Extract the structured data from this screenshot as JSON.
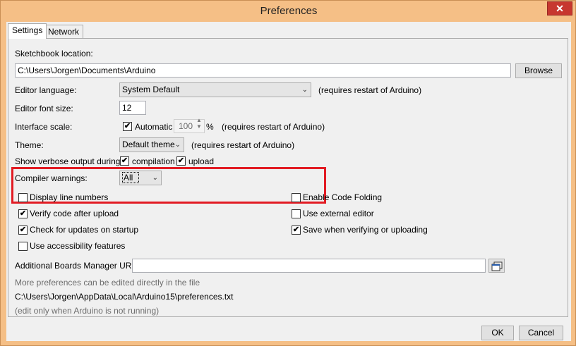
{
  "window": {
    "title": "Preferences",
    "close_glyph": "✕"
  },
  "tabs": [
    {
      "label": "Settings"
    },
    {
      "label": "Network"
    }
  ],
  "sketchbook": {
    "label": "Sketchbook location:",
    "value": "C:\\Users\\Jorgen\\Documents\\Arduino",
    "browse_label": "Browse"
  },
  "editor_language": {
    "label": "Editor language:",
    "value": "System Default",
    "note": "(requires restart of Arduino)"
  },
  "font_size": {
    "label": "Editor font size:",
    "value": "12"
  },
  "interface_scale": {
    "label": "Interface scale:",
    "automatic_label": "Automatic",
    "value": "100",
    "unit": "%",
    "note": "(requires restart of Arduino)"
  },
  "theme": {
    "label": "Theme:",
    "value": "Default theme",
    "note": "(requires restart of Arduino)"
  },
  "verbose": {
    "label": "Show verbose output during:",
    "compilation_label": "compilation",
    "upload_label": "upload"
  },
  "compiler_warnings": {
    "label": "Compiler warnings:",
    "value": "All"
  },
  "options_left": [
    {
      "label": "Display line numbers",
      "checked": false
    },
    {
      "label": "Verify code after upload",
      "checked": true
    },
    {
      "label": "Check for updates on startup",
      "checked": true
    },
    {
      "label": "Use accessibility features",
      "checked": false
    }
  ],
  "options_right": [
    {
      "label": "Enable Code Folding",
      "checked": false
    },
    {
      "label": "Use external editor",
      "checked": false
    },
    {
      "label": "Save when verifying or uploading",
      "checked": true
    }
  ],
  "boards_urls": {
    "label": "Additional Boards Manager URLs:",
    "value": ""
  },
  "footer": {
    "more_prefs": "More preferences can be edited directly in the file",
    "prefs_path": "C:\\Users\\Jorgen\\AppData\\Local\\Arduino15\\preferences.txt",
    "edit_note": "(edit only when Arduino is not running)"
  },
  "buttons": {
    "ok": "OK",
    "cancel": "Cancel"
  },
  "colors": {
    "highlight": "#e21b23"
  }
}
